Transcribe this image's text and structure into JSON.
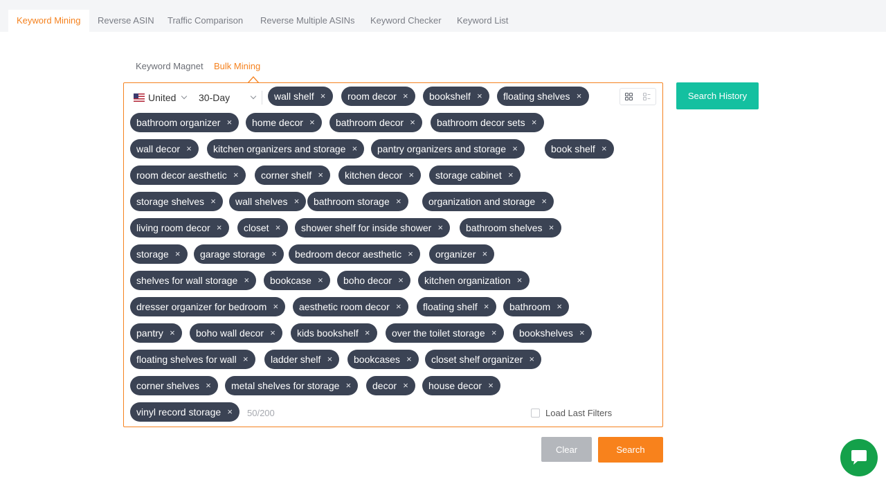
{
  "top_tabs": [
    {
      "label": "Keyword Mining",
      "active": true
    },
    {
      "label": "Reverse ASIN",
      "active": false
    },
    {
      "label": "Traffic Comparison",
      "active": false
    },
    {
      "label": "Reverse Multiple ASINs",
      "active": false
    },
    {
      "label": "Keyword Checker",
      "active": false
    },
    {
      "label": "Keyword List",
      "active": false
    }
  ],
  "sub_tabs": [
    {
      "label": "Keyword Magnet",
      "active": false
    },
    {
      "label": "Bulk Mining",
      "active": true
    }
  ],
  "filters": {
    "country": {
      "label": "United",
      "flag": "us-flag-icon"
    },
    "period": {
      "label": "30-Day"
    }
  },
  "keywords": [
    "wall shelf",
    "room decor",
    "bookshelf",
    "floating shelves",
    "bathroom organizer",
    "home decor",
    "bathroom decor",
    "bathroom decor sets",
    "wall decor",
    "kitchen organizers and storage",
    "pantry organizers and storage",
    "book shelf",
    "room decor aesthetic",
    "corner shelf",
    "kitchen decor",
    "storage cabinet",
    "storage shelves",
    "wall shelves",
    "bathroom storage",
    "organization and storage",
    "living room decor",
    "closet",
    "shower shelf for inside shower",
    "bathroom shelves",
    "storage",
    "garage storage",
    "bedroom decor aesthetic",
    "organizer",
    "shelves for wall storage",
    "bookcase",
    "boho decor",
    "kitchen organization",
    "dresser organizer for bedroom",
    "aesthetic room decor",
    "floating shelf",
    "bathroom",
    "pantry",
    "boho wall decor",
    "kids bookshelf",
    "over the toilet storage",
    "bookshelves",
    "floating shelves for wall",
    "ladder shelf",
    "bookcases",
    "closet shelf organizer",
    "corner shelves",
    "metal shelves for storage",
    "decor",
    "house decor",
    "vinyl record storage"
  ],
  "keyword_count": "50/200",
  "load_last_filters": {
    "label": "Load Last Filters",
    "checked": false
  },
  "buttons": {
    "search_history": "Search History",
    "clear": "Clear",
    "search": "Search"
  },
  "icons": {
    "tag_remove": "×",
    "view_grid": "grid-view-icon",
    "view_list": "list-view-icon",
    "chat": "chat-icon"
  },
  "colors": {
    "accent": "#f5821f",
    "tag_bg": "#3b4354",
    "history_button": "#14c0a0",
    "search_button": "#f8821c",
    "clear_button": "#b4b7bc",
    "chat_button": "#14a14a"
  }
}
